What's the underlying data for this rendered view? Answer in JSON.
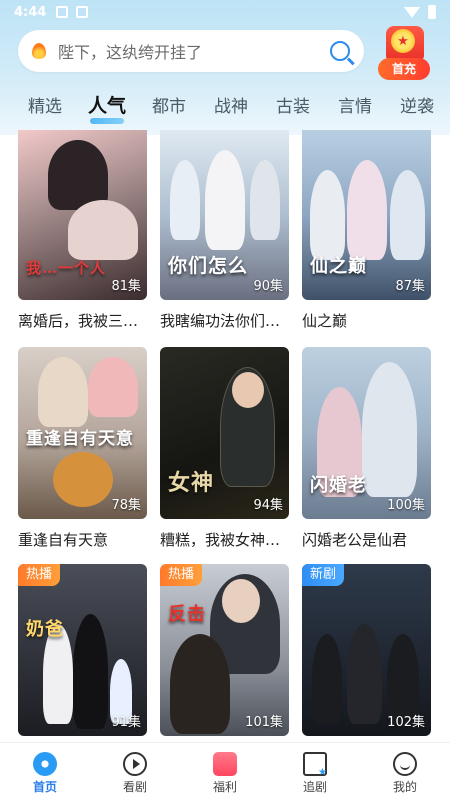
{
  "status_bar": {
    "time": "4:44"
  },
  "search": {
    "placeholder": "陛下，这纨绔开挂了"
  },
  "recharge": {
    "label": "首充",
    "coin_glyph": "★"
  },
  "tabs": [
    {
      "label": "精选",
      "active": false
    },
    {
      "label": "人气",
      "active": true
    },
    {
      "label": "都市",
      "active": false
    },
    {
      "label": "战神",
      "active": false
    },
    {
      "label": "古装",
      "active": false
    },
    {
      "label": "言情",
      "active": false
    },
    {
      "label": "逆袭",
      "active": false
    }
  ],
  "dramas": [
    {
      "title": "离婚后，我被三…",
      "episodes": "81集",
      "poster_text": "我…一个人",
      "badge": ""
    },
    {
      "title": "我瞎编功法你们…",
      "episodes": "90集",
      "poster_text": "你们怎么",
      "badge": ""
    },
    {
      "title": "仙之巅",
      "episodes": "87集",
      "poster_text": "仙之巅",
      "badge": ""
    },
    {
      "title": "重逢自有天意",
      "episodes": "78集",
      "poster_text": "重逢自有天意",
      "badge": ""
    },
    {
      "title": "糟糕，我被女神…",
      "episodes": "94集",
      "poster_text": "女神",
      "badge": ""
    },
    {
      "title": "闪婚老公是仙君",
      "episodes": "100集",
      "poster_text": "闪婚老",
      "badge": ""
    },
    {
      "title": "",
      "episodes": "91集",
      "poster_text": "奶爸",
      "badge": "热播"
    },
    {
      "title": "",
      "episodes": "101集",
      "poster_text": "反击",
      "badge": "热播"
    },
    {
      "title": "",
      "episodes": "102集",
      "poster_text": "",
      "badge": "新剧"
    }
  ],
  "bottom_nav": [
    {
      "label": "首页",
      "icon": "home-icon",
      "active": true
    },
    {
      "label": "看剧",
      "icon": "play-icon",
      "active": false
    },
    {
      "label": "福利",
      "icon": "gift-icon",
      "active": false
    },
    {
      "label": "追剧",
      "icon": "folder-star-icon",
      "active": false
    },
    {
      "label": "我的",
      "icon": "profile-icon",
      "active": false
    }
  ],
  "colors": {
    "accent": "#2a7de8",
    "hot_badge": "#ff7a2a",
    "new_badge": "#2f8df5"
  }
}
